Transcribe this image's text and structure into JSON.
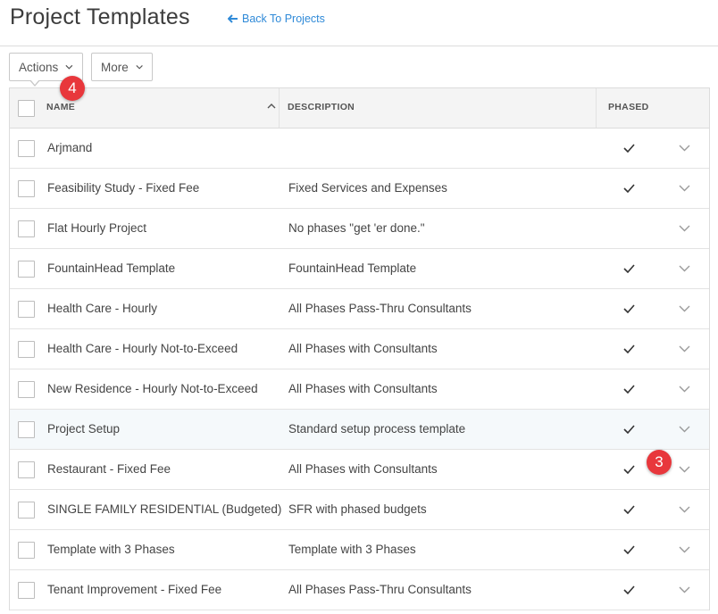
{
  "header": {
    "title": "Project Templates",
    "back_link": "Back To Projects"
  },
  "toolbar": {
    "actions_label": "Actions",
    "more_label": "More"
  },
  "table": {
    "columns": {
      "name": "NAME",
      "description": "DESCRIPTION",
      "phased": "PHASED"
    },
    "rows": [
      {
        "name": "Arjmand",
        "description": "",
        "phased": true
      },
      {
        "name": "Feasibility Study - Fixed Fee",
        "description": "Fixed Services and Expenses",
        "phased": true
      },
      {
        "name": "Flat Hourly Project",
        "description": "No phases \"get 'er done.\"",
        "phased": false
      },
      {
        "name": "FountainHead Template",
        "description": "FountainHead Template",
        "phased": true
      },
      {
        "name": "Health Care - Hourly",
        "description": "All Phases Pass-Thru Consultants",
        "phased": true
      },
      {
        "name": "Health Care - Hourly Not-to-Exceed",
        "description": "All Phases with Consultants",
        "phased": true
      },
      {
        "name": "New Residence - Hourly Not-to-Exceed",
        "description": "All Phases with Consultants",
        "phased": true
      },
      {
        "name": "Project Setup",
        "description": "Standard setup process template",
        "phased": true
      },
      {
        "name": "Restaurant - Fixed Fee",
        "description": "All Phases with Consultants",
        "phased": true
      },
      {
        "name": "SINGLE FAMILY RESIDENTIAL (Budgeted)",
        "description": "SFR with phased budgets",
        "phased": true
      },
      {
        "name": "Template with 3 Phases",
        "description": "Template with 3 Phases",
        "phased": true
      },
      {
        "name": "Tenant Improvement - Fixed Fee",
        "description": "All Phases Pass-Thru Consultants",
        "phased": true
      }
    ]
  },
  "annotations": {
    "badge_actions": "4",
    "badge_row": "3"
  },
  "icons": {
    "back": "arrow-left-icon",
    "dropdown": "chevron-down-icon",
    "sort": "chevron-up-icon",
    "phased": "check-icon"
  },
  "colors": {
    "link": "#2f8ad8",
    "badge": "#e8373c",
    "header_bg": "#f4f4f4",
    "highlight_row": "#f5f9fb"
  }
}
